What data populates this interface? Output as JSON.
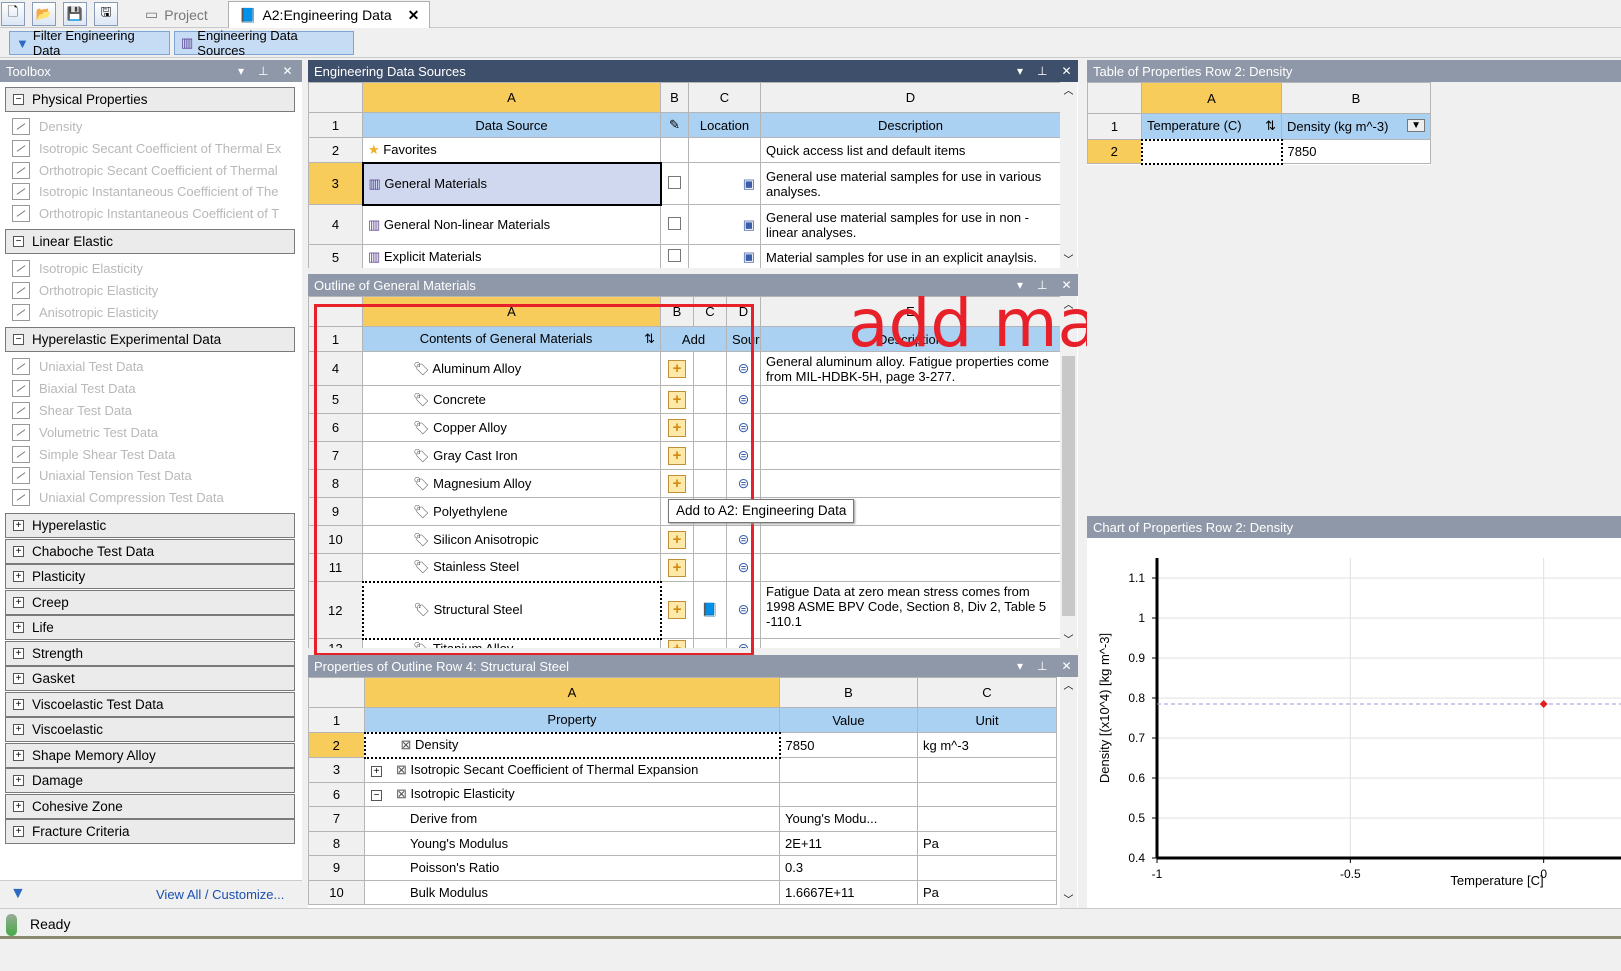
{
  "tabs": {
    "project": "Project",
    "engdata": "A2:Engineering Data"
  },
  "toolbar": {
    "filter": "Filter Engineering Data",
    "sources": "Engineering Data Sources"
  },
  "toolbox": {
    "title": "Toolbox",
    "footer": "View All / Customize...",
    "groups": [
      {
        "label": "Physical Properties",
        "open": true,
        "items": [
          "Density",
          "Isotropic Secant Coefficient of Thermal Ex",
          "Orthotropic Secant Coefficient of Thermal",
          "Isotropic Instantaneous Coefficient of The",
          "Orthotropic Instantaneous Coefficient of T"
        ]
      },
      {
        "label": "Linear Elastic",
        "open": true,
        "items": [
          "Isotropic Elasticity",
          "Orthotropic Elasticity",
          "Anisotropic Elasticity"
        ]
      },
      {
        "label": "Hyperelastic Experimental Data",
        "open": true,
        "items": [
          "Uniaxial Test Data",
          "Biaxial Test Data",
          "Shear Test Data",
          "Volumetric Test Data",
          "Simple Shear Test Data",
          "Uniaxial Tension Test Data",
          "Uniaxial Compression Test Data"
        ]
      },
      {
        "label": "Hyperelastic"
      },
      {
        "label": "Chaboche Test Data"
      },
      {
        "label": "Plasticity"
      },
      {
        "label": "Creep"
      },
      {
        "label": "Life"
      },
      {
        "label": "Strength"
      },
      {
        "label": "Gasket"
      },
      {
        "label": "Viscoelastic Test Data"
      },
      {
        "label": "Viscoelastic"
      },
      {
        "label": "Shape Memory Alloy"
      },
      {
        "label": "Damage"
      },
      {
        "label": "Cohesive Zone"
      },
      {
        "label": "Fracture Criteria"
      }
    ]
  },
  "sources": {
    "title": "Engineering Data Sources",
    "cols": [
      "A",
      "B",
      "C",
      "D"
    ],
    "header": [
      "Data Source",
      "Location",
      "Description"
    ],
    "rows": [
      {
        "n": "2",
        "name": "Favorites",
        "desc": "Quick access list and default items"
      },
      {
        "n": "3",
        "name": "General Materials",
        "desc": "General use material samples for use in various analyses."
      },
      {
        "n": "4",
        "name": "General Non-linear Materials",
        "desc": "General use material samples for use in non -linear analyses."
      },
      {
        "n": "5",
        "name": "Explicit Materials",
        "desc": "Material samples for use in an explicit anaylsis."
      }
    ]
  },
  "outline": {
    "title": "Outline of General Materials",
    "cols": [
      "A",
      "B",
      "C",
      "D",
      "E"
    ],
    "header": {
      "contents": "Contents of General Materials",
      "add": "Add",
      "source": "Sourc",
      "description": "Description"
    },
    "rows": [
      {
        "n": "4",
        "name": "Aluminum Alloy",
        "desc": "General aluminum alloy. Fatigue properties come from MIL-HDBK-5H, page 3-277."
      },
      {
        "n": "5",
        "name": "Concrete",
        "desc": ""
      },
      {
        "n": "6",
        "name": "Copper Alloy",
        "desc": ""
      },
      {
        "n": "7",
        "name": "Gray Cast Iron",
        "desc": ""
      },
      {
        "n": "8",
        "name": "Magnesium Alloy",
        "desc": ""
      },
      {
        "n": "9",
        "name": "Polyethylene",
        "desc": ""
      },
      {
        "n": "10",
        "name": "Silicon Anisotropic",
        "desc": ""
      },
      {
        "n": "11",
        "name": "Stainless Steel",
        "desc": ""
      },
      {
        "n": "12",
        "name": "Structural Steel",
        "desc": "Fatigue Data at zero mean stress comes from 1998 ASME BPV Code, Section 8, Div 2, Table 5 -110.1"
      },
      {
        "n": "13",
        "name": "Titanium Alloy",
        "desc": ""
      }
    ],
    "tooltip": "Add to A2: Engineering Data",
    "annotation": "add material as u wish"
  },
  "properties": {
    "title": "Properties of Outline Row 4: Structural Steel",
    "cols": [
      "A",
      "B",
      "C"
    ],
    "header": [
      "Property",
      "Value",
      "Unit"
    ],
    "rows": [
      {
        "n": "2",
        "name": "Density",
        "value": "7850",
        "unit": "kg m^-3"
      },
      {
        "n": "3",
        "name": "Isotropic Secant Coefficient of Thermal Expansion",
        "value": "",
        "unit": ""
      },
      {
        "n": "6",
        "name": "Isotropic Elasticity",
        "value": "",
        "unit": ""
      },
      {
        "n": "7",
        "name": "Derive from",
        "value": "Young's Modu...",
        "unit": ""
      },
      {
        "n": "8",
        "name": "Young's Modulus",
        "value": "2E+11",
        "unit": "Pa"
      },
      {
        "n": "9",
        "name": "Poisson's Ratio",
        "value": "0.3",
        "unit": ""
      },
      {
        "n": "10",
        "name": "Bulk Modulus",
        "value": "1.6667E+11",
        "unit": "Pa"
      }
    ]
  },
  "table": {
    "title": "Table of Properties Row 2: Density",
    "cols": [
      "A",
      "B"
    ],
    "header": [
      "Temperature (C)",
      "Density (kg m^-3)"
    ],
    "row": {
      "n": "2",
      "temp": "",
      "density": "7850"
    }
  },
  "chart": {
    "title": "Chart of Properties Row 2: Density"
  },
  "chart_data": {
    "type": "scatter",
    "xlabel": "Temperature [C]",
    "ylabel": "Density [(x10^4) [kg m^-3]",
    "xticks": [
      "-1",
      "-0.5",
      "0"
    ],
    "yticks": [
      "1.1",
      "1",
      "0.9",
      "0.8",
      "0.7",
      "0.6",
      "0.5",
      "0.4"
    ],
    "xlim": [
      -1,
      0.2
    ],
    "ylim": [
      0.4,
      1.15
    ],
    "points": [
      {
        "x": 0,
        "y": 0.785
      }
    ]
  },
  "status": {
    "text": "Ready"
  },
  "row_nums": {
    "r1": "1"
  }
}
